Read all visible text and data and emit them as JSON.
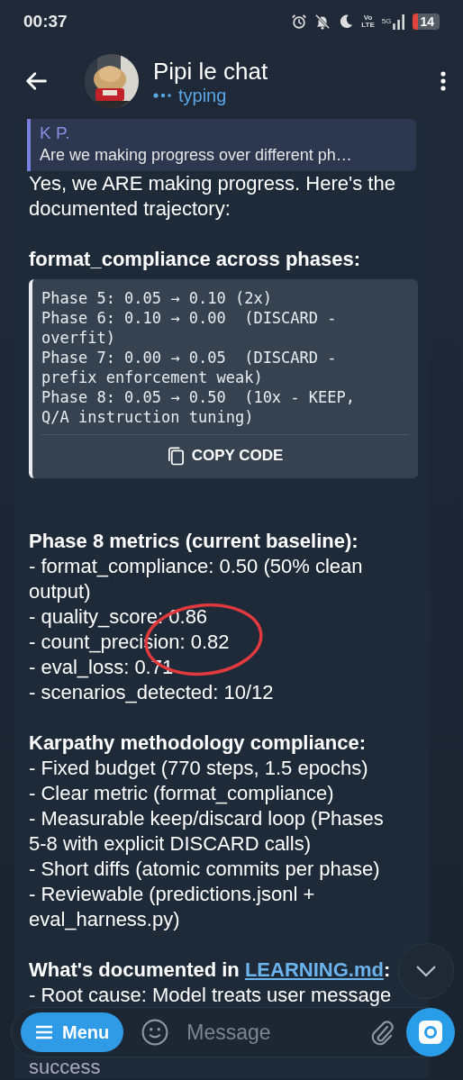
{
  "status_bar": {
    "time": "00:37",
    "volte_top": "Vo",
    "volte_bottom": "LTE",
    "network": "5G",
    "battery": "14"
  },
  "header": {
    "title": "Pipi le chat",
    "status": "typing"
  },
  "message": {
    "reply": {
      "author": "K P.",
      "text": "Are we making progress over different ph…"
    },
    "blocks": [
      {
        "kind": "text",
        "text": "Yes, we ARE making progress. Here's the documented trajectory:"
      },
      {
        "kind": "heading",
        "text": "format_compliance across phases:"
      },
      {
        "kind": "code",
        "lines": [
          "Phase 5: 0.05 → 0.10 (2x)",
          "Phase 6: 0.10 → 0.00  (DISCARD - overfit)",
          "Phase 7: 0.00 → 0.05  (DISCARD - prefix enforcement weak)",
          "Phase 8: 0.05 → 0.50  (10x - KEEP, Q/A instruction tuning)"
        ],
        "copy_label": "COPY CODE"
      },
      {
        "kind": "heading",
        "text": "Phase 8 metrics (current baseline):"
      },
      {
        "kind": "list",
        "items": [
          "- format_compliance: 0.50 (50% clean output)",
          "- quality_score: 0.86",
          "- count_precision: 0.82",
          "- eval_loss: 0.71",
          "- scenarios_detected: 10/12"
        ]
      },
      {
        "kind": "heading",
        "text": "Karpathy methodology compliance:"
      },
      {
        "kind": "list",
        "items": [
          "- Fixed budget (770 steps, 1.5 epochs)",
          "- Clear metric (format_compliance)",
          "- Measurable keep/discard loop (Phases 5-8 with explicit DISCARD calls)",
          "- Short diffs (atomic commits per phase)",
          "- Reviewable (predictions.jsonl + eval_harness.py)"
        ]
      },
      {
        "kind": "heading",
        "text": "What's documented in ",
        "link": "LEARNING.md",
        "suffix": ":"
      },
      {
        "kind": "list",
        "items": [
          "- Root cause: Model treats user message"
        ]
      },
      {
        "kind": "tail",
        "text": "success"
      }
    ]
  },
  "composer": {
    "menu_label": "Menu",
    "placeholder": "Message"
  }
}
